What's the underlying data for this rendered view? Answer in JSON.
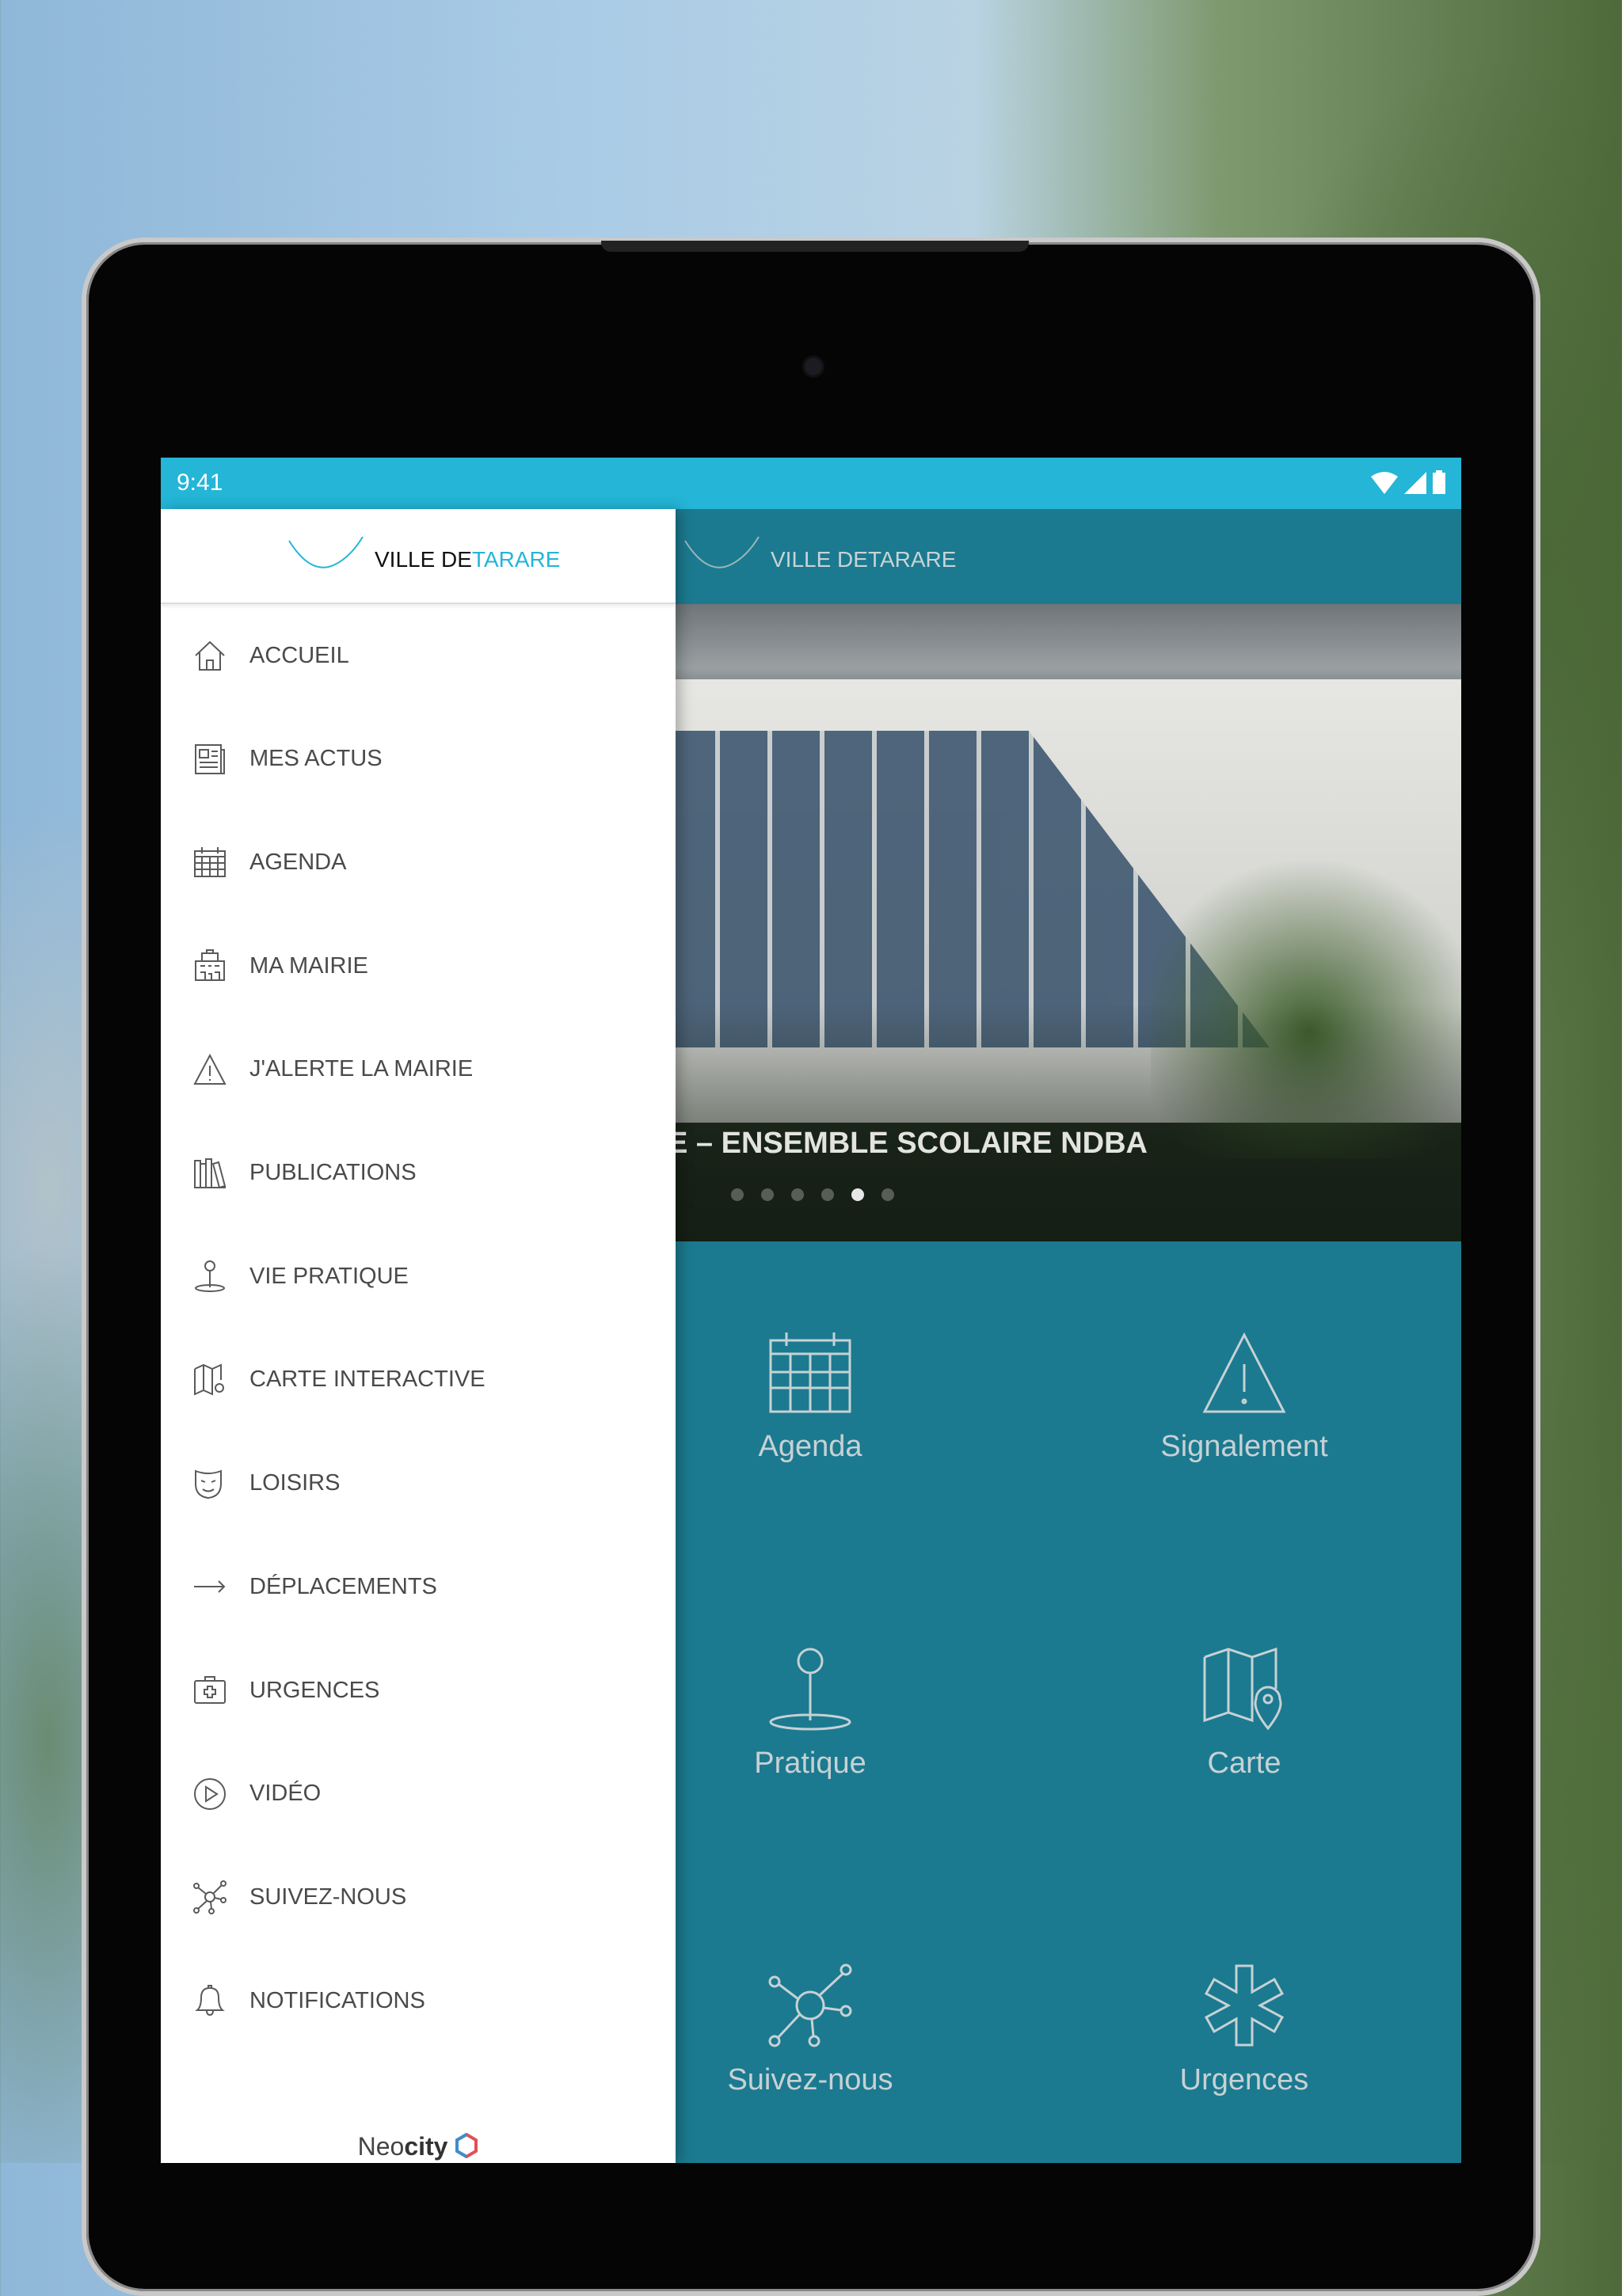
{
  "status_bar": {
    "time": "9:41",
    "icons": [
      "wifi-icon",
      "signal-icon",
      "battery-icon"
    ]
  },
  "app_bar": {
    "logo_text_1": "VILLE DE ",
    "logo_text_2": "TARARE"
  },
  "drawer": {
    "logo_text_1": "VILLE DE ",
    "logo_text_2": "TARARE",
    "items": [
      {
        "label": "ACCUEIL",
        "icon": "home-icon"
      },
      {
        "label": "MES ACTUS",
        "icon": "newspaper-icon"
      },
      {
        "label": "AGENDA",
        "icon": "calendar-icon"
      },
      {
        "label": "MA MAIRIE",
        "icon": "town-hall-icon"
      },
      {
        "label": "J'ALERTE LA MAIRIE",
        "icon": "warning-icon"
      },
      {
        "label": "PUBLICATIONS",
        "icon": "books-icon"
      },
      {
        "label": "VIE PRATIQUE",
        "icon": "joystick-pin-icon"
      },
      {
        "label": "CARTE INTERACTIVE",
        "icon": "map-icon"
      },
      {
        "label": "LOISIRS",
        "icon": "theater-masks-icon"
      },
      {
        "label": "DÉPLACEMENTS",
        "icon": "arrow-right-icon"
      },
      {
        "label": "URGENCES",
        "icon": "first-aid-icon"
      },
      {
        "label": "VIDÉO",
        "icon": "play-icon"
      },
      {
        "label": "SUIVEZ-NOUS",
        "icon": "network-icon"
      },
      {
        "label": "NOTIFICATIONS",
        "icon": "bell-icon"
      }
    ],
    "footer": {
      "brand_1": "Neo",
      "brand_2": "city"
    }
  },
  "slider": {
    "caption": "E – ENSEMBLE SCOLAIRE NDBA",
    "dot_count": 6,
    "active_dot": 5
  },
  "tiles": [
    {
      "label": "Agenda",
      "icon": "calendar-icon"
    },
    {
      "label": "Signalement",
      "icon": "warning-icon"
    },
    {
      "label": "Pratique",
      "icon": "joystick-pin-icon"
    },
    {
      "label": "Carte",
      "icon": "map-pin-icon"
    },
    {
      "label": "Suivez-nous",
      "icon": "network-icon"
    },
    {
      "label": "Urgences",
      "icon": "star-of-life-icon"
    }
  ],
  "colors": {
    "status_bar": "#24b5d7",
    "app_bar": "#1b7a8f",
    "accent": "#24b5d7"
  }
}
